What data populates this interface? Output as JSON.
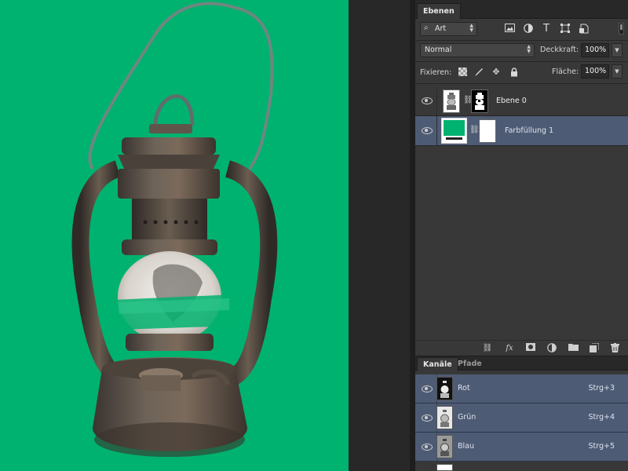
{
  "colors": {
    "fill_color": "#00b26f",
    "selected_row": "#4e5b74",
    "panel_bg": "#383838",
    "dark_bg": "#282828"
  },
  "layers_panel": {
    "tab_label": "Ebenen",
    "filter": {
      "icon": "search-icon",
      "value": "Art"
    },
    "filter_icons": [
      "image-filter-icon",
      "adjustment-filter-icon",
      "type-filter-icon",
      "shape-filter-icon",
      "smart-object-filter-icon"
    ],
    "type_filter_glyph": "T",
    "blend_mode": "Normal",
    "opacity_label": "Deckkraft:",
    "opacity_value": "100%",
    "lock_label": "Fixieren:",
    "lock_icons": [
      "lock-transparent-icon",
      "lock-image-icon",
      "lock-position-icon",
      "lock-all-icon"
    ],
    "fill_label": "Fläche:",
    "fill_value": "100%",
    "layers": [
      {
        "name": "Ebene 0",
        "selected": false
      },
      {
        "name": "Farbfüllung 1",
        "selected": true
      }
    ],
    "footer_icons": [
      "link-layers-icon",
      "fx-icon",
      "add-mask-icon",
      "new-adjustment-icon",
      "new-group-icon",
      "new-layer-icon",
      "trash-icon"
    ],
    "fx_glyph": "fx"
  },
  "channels_panel": {
    "tabs": [
      {
        "label": "Kanäle",
        "active": true
      },
      {
        "label": "Pfade",
        "active": false
      }
    ],
    "channels": [
      {
        "name": "Rot",
        "shortcut": "Strg+3"
      },
      {
        "name": "Grün",
        "shortcut": "Strg+4"
      },
      {
        "name": "Blau",
        "shortcut": "Strg+5"
      }
    ]
  }
}
